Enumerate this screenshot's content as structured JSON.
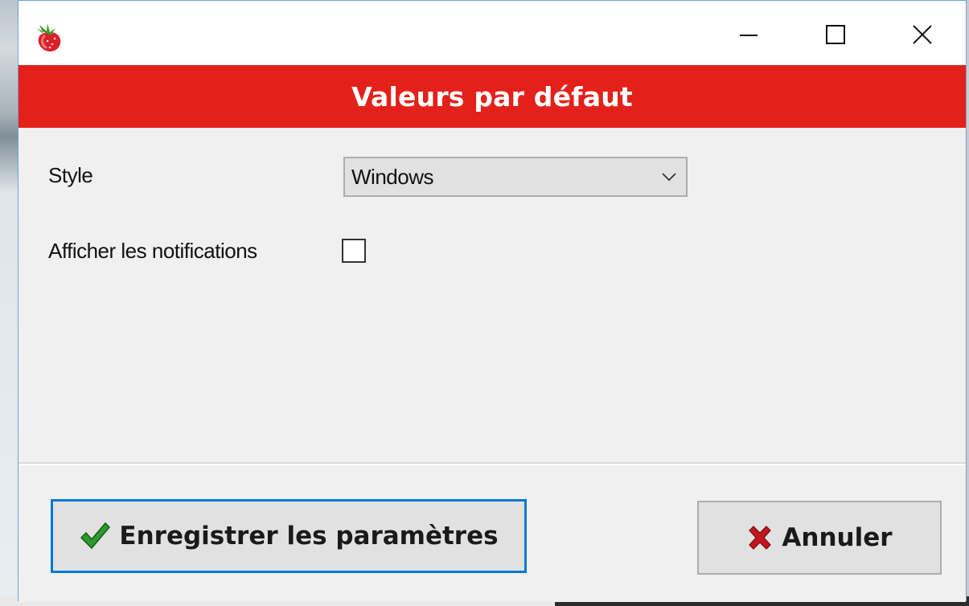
{
  "window": {
    "title_icon": "strawberry-icon",
    "controls": {
      "minimize": "minimize-icon",
      "maximize": "maximize-icon",
      "close": "close-icon"
    }
  },
  "header": {
    "title": "Valeurs par défaut",
    "background_color": "#e3211a",
    "text_color": "#ffffff"
  },
  "form": {
    "style_label": "Style",
    "style_value": "Windows",
    "notifications_label": "Afficher les notifications",
    "notifications_checked": false
  },
  "buttons": {
    "save_label": "Enregistrer les paramètres",
    "save_icon": "checkmark-icon",
    "cancel_label": "Annuler",
    "cancel_icon": "x-cross-icon"
  },
  "colors": {
    "focus_border": "#0078d7",
    "check_green": "#2e9a2e",
    "cross_red": "#c0171d"
  }
}
